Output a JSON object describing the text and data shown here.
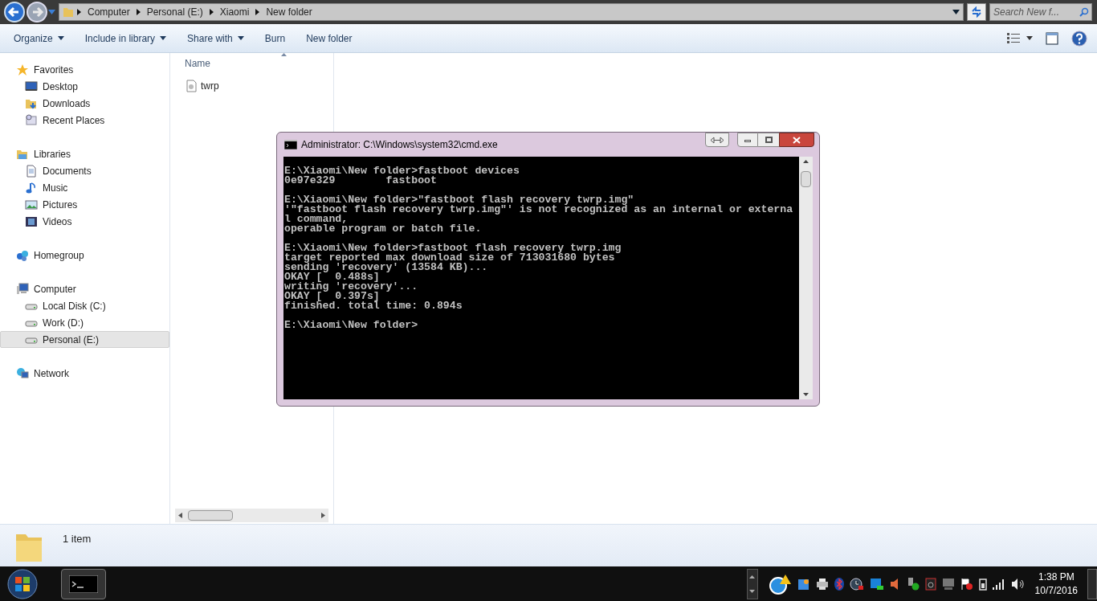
{
  "address_bar": {
    "crumbs": [
      "Computer",
      "Personal (E:)",
      "Xiaomi",
      "New folder"
    ],
    "search": {
      "placeholder": "Search New f..."
    }
  },
  "toolbar": [
    {
      "label": "Organize",
      "dropdown": true
    },
    {
      "label": "Include in library",
      "dropdown": true
    },
    {
      "label": "Share with",
      "dropdown": true
    },
    {
      "label": "Burn",
      "dropdown": false
    },
    {
      "label": "New folder",
      "dropdown": false
    }
  ],
  "sidebar": [
    {
      "label": "Favorites",
      "kind": "favorites",
      "selected": false,
      "children": [
        {
          "label": "Desktop",
          "kind": "desktop",
          "selected": false
        },
        {
          "label": "Downloads",
          "kind": "downloads",
          "selected": false
        },
        {
          "label": "Recent Places",
          "kind": "recent",
          "selected": false
        }
      ]
    },
    {
      "label": "Libraries",
      "kind": "libraries",
      "selected": false,
      "children": [
        {
          "label": "Documents",
          "kind": "documents",
          "selected": false
        },
        {
          "label": "Music",
          "kind": "music",
          "selected": false
        },
        {
          "label": "Pictures",
          "kind": "pictures",
          "selected": false
        },
        {
          "label": "Videos",
          "kind": "videos",
          "selected": false
        }
      ]
    },
    {
      "label": "Homegroup",
      "kind": "homegroup",
      "selected": false
    },
    {
      "label": "Computer",
      "kind": "computer",
      "selected": false,
      "children": [
        {
          "label": "Local Disk (C:)",
          "kind": "disk",
          "selected": false
        },
        {
          "label": "Work (D:)",
          "kind": "disk",
          "selected": false
        },
        {
          "label": "Personal (E:)",
          "kind": "disk",
          "selected": true
        }
      ]
    },
    {
      "label": "Network",
      "kind": "network",
      "selected": false
    }
  ],
  "file_list": {
    "column": "Name",
    "files": [
      {
        "name": "twrp",
        "selected": false
      }
    ]
  },
  "status_bar": {
    "count": "1 item"
  },
  "cmd_window": {
    "title": "Administrator: C:\\Windows\\system32\\cmd.exe",
    "blocks": [
      [
        "E:\\Xiaomi\\New folder>fastboot devices",
        "0e97e329        fastboot"
      ],
      [
        "E:\\Xiaomi\\New folder>\"fastboot flash recovery twrp.img\"",
        "'\"fastboot flash recovery twrp.img\"' is not recognized as an internal or externa",
        "l command,",
        "operable program or batch file."
      ],
      [
        "E:\\Xiaomi\\New folder>fastboot flash recovery twrp.img",
        "target reported max download size of 713031680 bytes",
        "sending 'recovery' (13584 KB)...",
        "OKAY [  0.488s]",
        "writing 'recovery'...",
        "OKAY [  0.397s]",
        "finished. total time: 0.894s"
      ],
      [
        "E:\\Xiaomi\\New folder>"
      ]
    ]
  },
  "taskbar": {
    "clock": {
      "time": "1:38 PM",
      "date": "10/7/2016"
    }
  }
}
